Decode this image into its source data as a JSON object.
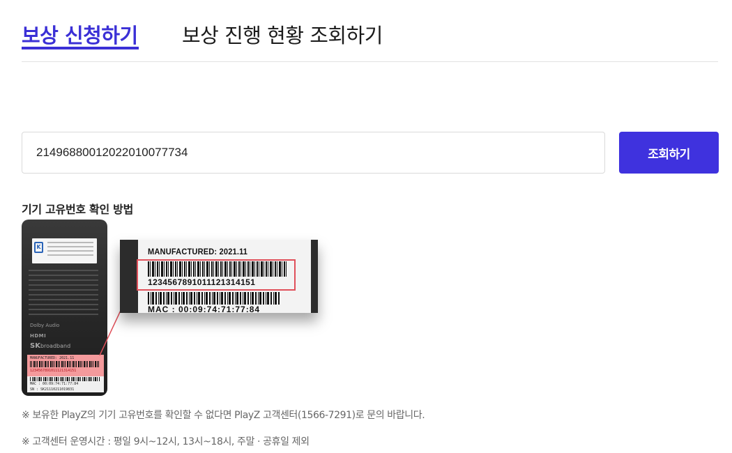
{
  "tabs": {
    "apply_label": "보상 신청하기",
    "status_label": "보상 진행 현황 조회하기"
  },
  "search": {
    "value": "21496880012022010077734",
    "button_label": "조회하기"
  },
  "guide": {
    "title": "기기 고유번호 확인 방법",
    "label": {
      "manufactured": "MANUFACTURED: 2021.11",
      "serial": "1234567891011121314151",
      "mac": "MAC : 00:09:74:71:77:84",
      "sn": "SN : SK21110211019831"
    },
    "device": {
      "brand": "SK",
      "brand_suffix": "broadband",
      "audio_logo": "Dolby Audio",
      "hdmi_logo": "HDMI",
      "kc_mark": "K"
    },
    "highlight_color": "#e0505a"
  },
  "notices": {
    "contact": "※ 보유한 PlayZ의 기기 고유번호를 확인할 수 없다면 PlayZ 고객센터(1566-7291)로 문의 바랍니다.",
    "hours": "※ 고객센터 운영시간 : 평일 9시~12시, 13시~18시, 주말 · 공휴일 제외"
  },
  "colors": {
    "accent": "#3b30d6",
    "button": "#3f32de"
  }
}
